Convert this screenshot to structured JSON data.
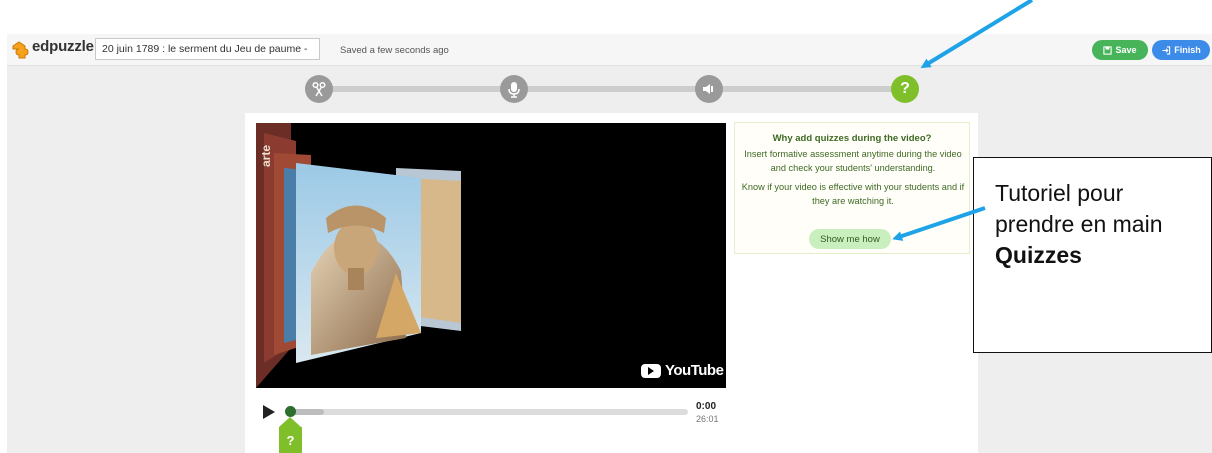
{
  "app": {
    "logo_text": "edpuzzle",
    "title_value": "20 juin 1789 : le serment du Jeu de paume - ",
    "save_status": "Saved a few seconds ago",
    "save_label": "Save",
    "finish_label": "Finish"
  },
  "tools": {
    "cut": "scissors-icon",
    "voiceover": "microphone-icon",
    "audio_note": "speaker-icon",
    "quiz": "?"
  },
  "video": {
    "watermark": "YouTube",
    "channel_badge": "arte",
    "time_current": "0:00",
    "time_total": "26:01",
    "quiz_marker": "?"
  },
  "info_box": {
    "title": "Why add quizzes during the video?",
    "text_1": "Insert formative assessment anytime during the video and check your students' understanding.",
    "text_2": "Know if your video is effective with your students and if they are watching it.",
    "button_label": "Show me how"
  },
  "annotation": {
    "text": "Tutoriel pour prendre en main",
    "strong": "Quizzes"
  },
  "colors": {
    "accent_green": "#7fbf2a",
    "save_green": "#47b45a",
    "finish_blue": "#3d8be9",
    "arrow_blue": "#1ea3e8"
  }
}
